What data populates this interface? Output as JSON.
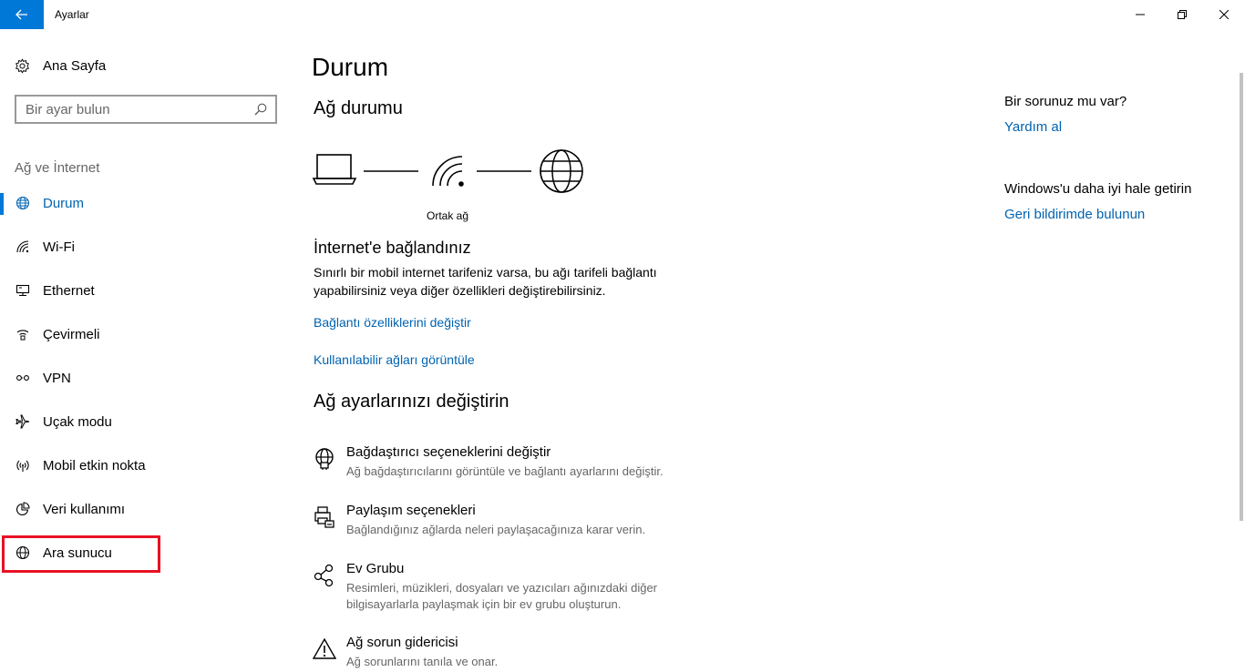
{
  "window": {
    "title": "Ayarlar",
    "accent_color": "#0078d7",
    "link_color": "#0063b1",
    "highlight_color": "#e81123"
  },
  "sidebar": {
    "home_label": "Ana Sayfa",
    "search_placeholder": "Bir ayar bulun",
    "section_header": "Ağ ve İnternet",
    "items": [
      {
        "label": "Durum",
        "icon": "globe-network-icon",
        "active": true
      },
      {
        "label": "Wi-Fi",
        "icon": "wifi-icon"
      },
      {
        "label": "Ethernet",
        "icon": "ethernet-icon"
      },
      {
        "label": "Çevirmeli",
        "icon": "dialup-icon"
      },
      {
        "label": "VPN",
        "icon": "vpn-icon"
      },
      {
        "label": "Uçak modu",
        "icon": "airplane-icon"
      },
      {
        "label": "Mobil etkin nokta",
        "icon": "hotspot-icon"
      },
      {
        "label": "Veri kullanımı",
        "icon": "pie-chart-icon"
      },
      {
        "label": "Ara sunucu",
        "icon": "globe-icon",
        "highlighted": true
      }
    ]
  },
  "main": {
    "title": "Durum",
    "network_status_title": "Ağ durumu",
    "network_label": "Ortak ağ",
    "connected_title": "İnternet'e bağlandınız",
    "connected_desc": "Sınırlı bir mobil internet tarifeniz varsa, bu ağı tarifeli bağlantı yapabilirsiniz veya diğer özellikleri değiştirebilirsiniz.",
    "links": [
      "Bağlantı özelliklerini değiştir",
      "Kullanılabilir ağları görüntüle"
    ],
    "change_settings_title": "Ağ ayarlarınızı değiştirin",
    "settings": [
      {
        "title": "Bağdaştırıcı seçeneklerini değiştir",
        "desc": "Ağ bağdaştırıcılarını görüntüle ve bağlantı ayarlarını değiştir.",
        "icon": "adapter-icon"
      },
      {
        "title": "Paylaşım seçenekleri",
        "desc": "Bağlandığınız ağlarda neleri paylaşacağınıza karar verin.",
        "icon": "sharing-icon"
      },
      {
        "title": "Ev Grubu",
        "desc": "Resimleri, müzikleri, dosyaları ve yazıcıları ağınızdaki diğer bilgisayarlarla paylaşmak için bir ev grubu oluşturun.",
        "icon": "homegroup-icon"
      },
      {
        "title": "Ağ sorun gidericisi",
        "desc": "Ağ sorunlarını tanıla ve onar.",
        "icon": "warning-icon"
      }
    ]
  },
  "right_panel": {
    "question": "Bir sorunuz mu var?",
    "help_link": "Yardım al",
    "improve_text": "Windows'u daha iyi hale getirin",
    "feedback_link": "Geri bildirimde bulunun"
  }
}
